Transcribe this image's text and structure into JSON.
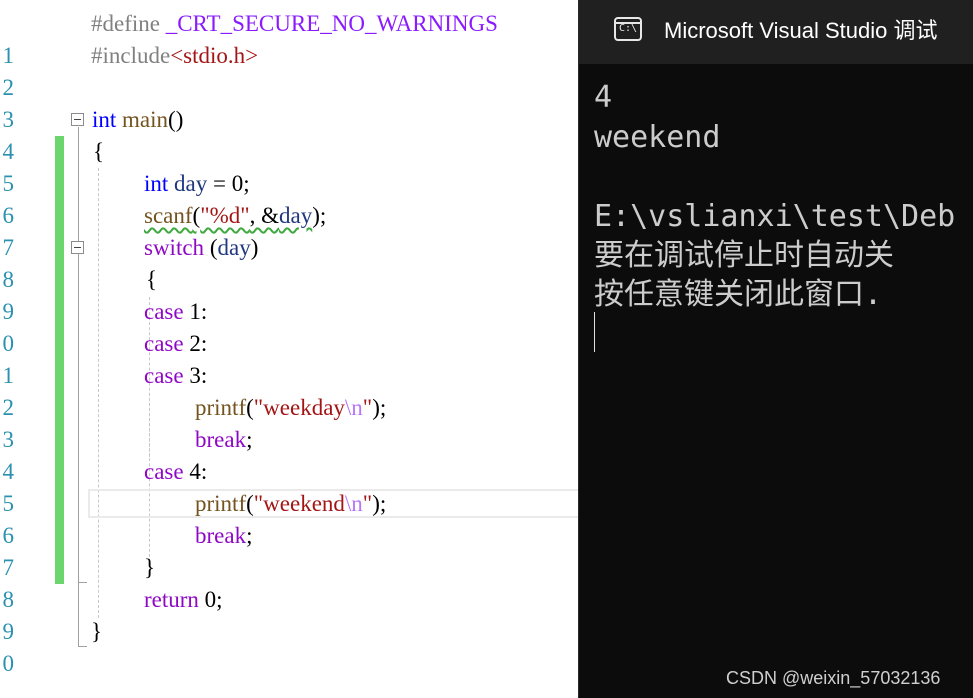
{
  "editor": {
    "line_numbers": [
      "1",
      "2",
      "3",
      "4",
      "5",
      "6",
      "7",
      "8",
      "9",
      "0",
      "1",
      "2",
      "3",
      "4",
      "5",
      "6",
      "7",
      "8",
      "9",
      "0"
    ],
    "l1": {
      "define": "#define",
      "macro": "_CRT_SECURE_NO_WARNINGS"
    },
    "l2": {
      "include": "#include",
      "header": "<stdio.h>"
    },
    "l4": {
      "type": "int",
      "name": "main",
      "parens": "()"
    },
    "l5": {
      "brace": "{"
    },
    "l6": {
      "type": "int",
      "var": "day",
      "rest": " = 0;"
    },
    "l7": {
      "fn": "scanf",
      "open": "(",
      "fmt": "\"%d\"",
      "mid": ", &",
      "var": "day",
      "close": ");"
    },
    "l8": {
      "kw": "switch",
      "open": " (",
      "var": "day",
      "close": ")"
    },
    "l9": {
      "brace": "{"
    },
    "l10": {
      "kw": "case",
      "rest": " 1:"
    },
    "l11": {
      "kw": "case",
      "rest": " 2:"
    },
    "l12": {
      "kw": "case",
      "rest": " 3:"
    },
    "l13": {
      "fn": "printf",
      "open": "(",
      "str_open": "\"weekday",
      "esc": "\\n",
      "str_close": "\"",
      "close": ");"
    },
    "l14": {
      "kw": "break",
      "rest": ";"
    },
    "l15": {
      "kw": "case",
      "rest": " 4:"
    },
    "l16": {
      "fn": "printf",
      "open": "(",
      "str_open": "\"weekend",
      "esc": "\\n",
      "str_close": "\"",
      "close": ");"
    },
    "l17": {
      "kw": "break",
      "rest": ";"
    },
    "l18": {
      "brace": "}"
    },
    "l19": {
      "kw": "return",
      "rest": " 0;"
    },
    "l20": {
      "brace": "}"
    }
  },
  "console": {
    "title": "Microsoft Visual Studio 调试",
    "icon": "terminal-icon",
    "icon_glyph": "C:\\",
    "lines": [
      "4",
      "weekend",
      "",
      "E:\\vslianxi\\test\\Deb",
      "要在调试停止时自动关",
      "按任意键关闭此窗口."
    ]
  },
  "watermark": "CSDN @weixin_57032136"
}
